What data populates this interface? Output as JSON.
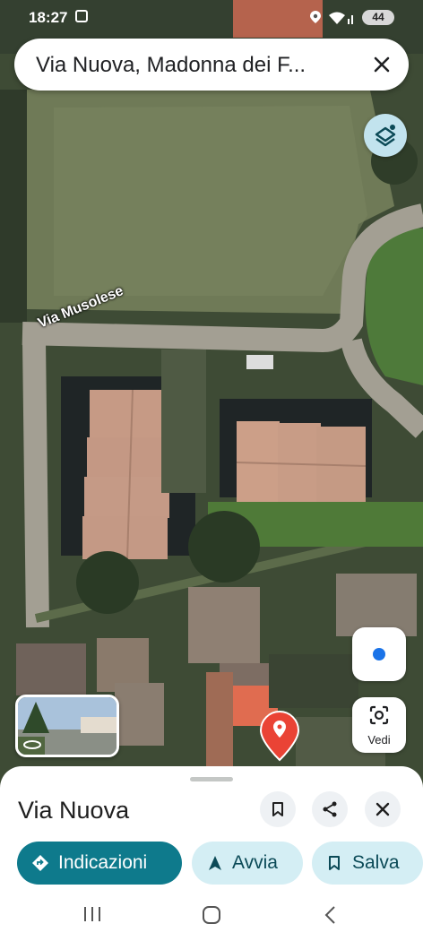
{
  "status_bar": {
    "time": "18:27",
    "battery": "44"
  },
  "search": {
    "query": "Via Nuova, Madonna dei F..."
  },
  "map": {
    "road_label": "Via Musolese"
  },
  "controls": {
    "view_label": "Vedi"
  },
  "place": {
    "name": "Via Nuova"
  },
  "actions": {
    "directions": "Indicazioni",
    "start": "Avvia",
    "save": "Salva"
  },
  "colors": {
    "accent": "#0e7a8c",
    "chip_bg": "#d4eef4",
    "pin": "#ea4335",
    "location_dot": "#1a73e8"
  },
  "icons": [
    "screen-record-icon",
    "location-icon",
    "wifi-icon",
    "close-icon",
    "layers-icon",
    "my-location-icon",
    "lens-icon",
    "pin-icon",
    "bookmark-icon",
    "share-icon",
    "directions-icon",
    "navigation-icon",
    "recents-icon",
    "home-icon",
    "back-icon"
  ]
}
